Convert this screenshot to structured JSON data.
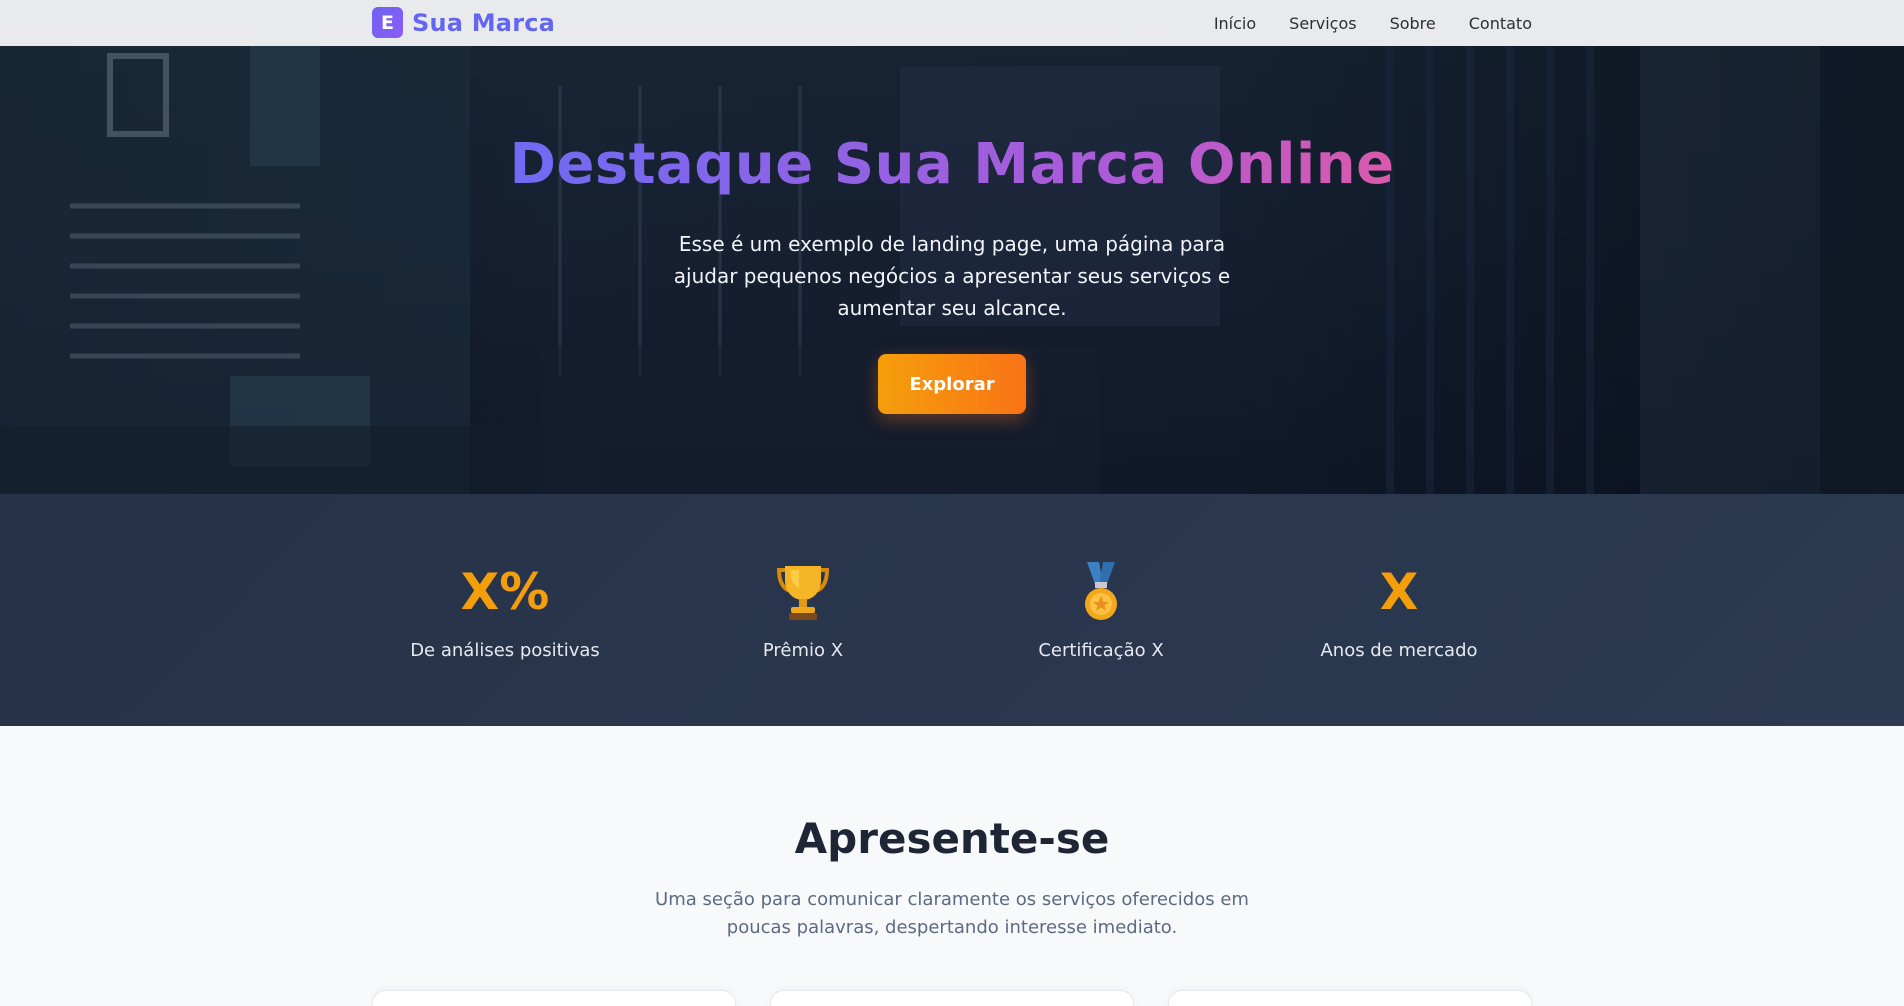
{
  "navbar": {
    "logo_letter": "E",
    "brand": "Sua Marca",
    "links": [
      "Início",
      "Serviços",
      "Sobre",
      "Contato"
    ]
  },
  "hero": {
    "title": "Destaque Sua Marca Online",
    "text": "Esse é um exemplo de landing page, uma página para ajudar pequenos negócios a apresentar seus serviços e aumentar seu alcance.",
    "button": "Explorar"
  },
  "stats": [
    {
      "value": "X%",
      "label": "De análises positivas"
    },
    {
      "icon": "trophy-icon",
      "label": "Prêmio X"
    },
    {
      "icon": "medal-icon",
      "label": "Certificação X"
    },
    {
      "value": "X",
      "label": "Anos de mercado"
    }
  ],
  "about": {
    "title": "Apresente-se",
    "text": "Uma seção para comunicar claramente os serviços oferecidos em poucas palavras, despertando interesse imediato."
  },
  "colors": {
    "brand": "#6366f1",
    "accent": "#f59e0b",
    "stats_bg": "#2a364c"
  }
}
